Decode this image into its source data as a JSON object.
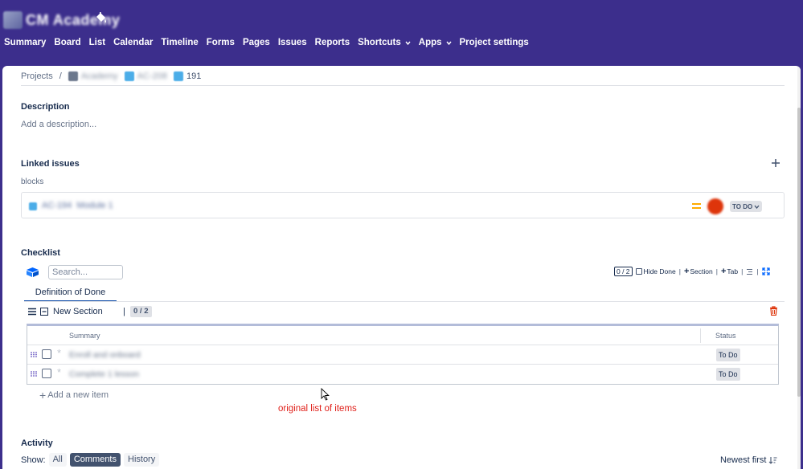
{
  "app": {
    "title": "CM Academy",
    "nav": [
      {
        "label": "Summary",
        "dropdown": false
      },
      {
        "label": "Board",
        "dropdown": false
      },
      {
        "label": "List",
        "dropdown": false
      },
      {
        "label": "Calendar",
        "dropdown": false
      },
      {
        "label": "Timeline",
        "dropdown": false
      },
      {
        "label": "Forms",
        "dropdown": false
      },
      {
        "label": "Pages",
        "dropdown": false
      },
      {
        "label": "Issues",
        "dropdown": false
      },
      {
        "label": "Reports",
        "dropdown": false
      },
      {
        "label": "Shortcuts",
        "dropdown": true
      },
      {
        "label": "Apps",
        "dropdown": true
      },
      {
        "label": "Project settings",
        "dropdown": false
      }
    ]
  },
  "breadcrumb": {
    "root": "Projects",
    "separator": "/",
    "project": "Academy",
    "parent": "AC-208",
    "issue_number": "191"
  },
  "description": {
    "heading": "Description",
    "placeholder": "Add a description..."
  },
  "linked_issues": {
    "heading": "Linked issues",
    "link_type": "blocks",
    "items": [
      {
        "key": "AC-194",
        "summary": "Module 1",
        "status": "TO DO"
      }
    ]
  },
  "checklist": {
    "heading": "Checklist",
    "search_placeholder": "Search...",
    "count": "0 / 2",
    "hide_done": "Hide Done",
    "section_btn": "Section",
    "tab_btn": "Tab",
    "tab": "Definition of Done",
    "section": {
      "name": "New Section",
      "bar": "|",
      "count": "0 / 2"
    },
    "columns": {
      "summary": "Summary",
      "status": "Status"
    },
    "items": [
      {
        "summary": "Enroll and onboard",
        "status": "To Do"
      },
      {
        "summary": "Complete 1 lesson",
        "status": "To Do"
      }
    ],
    "add_item": "Add a new item"
  },
  "annotation": "original list of items",
  "activity": {
    "heading": "Activity",
    "show_label": "Show:",
    "filters": [
      "All",
      "Comments",
      "History"
    ],
    "active_filter": "Comments",
    "sort": "Newest first"
  },
  "colors": {
    "header": "#3c2e8c",
    "accent": "#0747a6",
    "annotation": "#e0201a",
    "delete": "#de350b"
  }
}
